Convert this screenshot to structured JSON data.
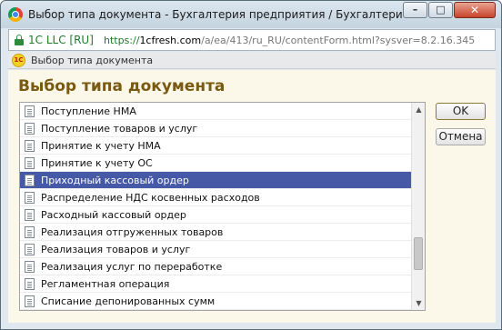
{
  "window": {
    "title": "Выбор типа документа - Бухгалтерия предприятия / Бухгалтерия предпр",
    "minimize_glyph": "–",
    "maximize_glyph": "□",
    "close_glyph": "✕"
  },
  "address_bar": {
    "cert_label": "1C LLC [RU]",
    "url_scheme": "https://",
    "url_host": "1cfresh.com",
    "url_path": "/a/ea/413/ru_RU/contentForm.html?sysver=8.2.16.345"
  },
  "page_strip": {
    "icon_text": "1С",
    "label": "Выбор типа документа"
  },
  "form": {
    "title": "Выбор типа документа",
    "items": [
      {
        "label": "Поступление НМА",
        "selected": false
      },
      {
        "label": "Поступление товаров и услуг",
        "selected": false
      },
      {
        "label": "Принятие к учету НМА",
        "selected": false
      },
      {
        "label": "Принятие к учету ОС",
        "selected": false
      },
      {
        "label": "Приходный кассовый ордер",
        "selected": true
      },
      {
        "label": "Распределение НДС косвенных расходов",
        "selected": false
      },
      {
        "label": "Расходный кассовый ордер",
        "selected": false
      },
      {
        "label": "Реализация отгруженных товаров",
        "selected": false
      },
      {
        "label": "Реализация товаров и услуг",
        "selected": false
      },
      {
        "label": "Реализация услуг по переработке",
        "selected": false
      },
      {
        "label": "Регламентная операция",
        "selected": false
      },
      {
        "label": "Списание депонированных сумм",
        "selected": false
      }
    ],
    "buttons": {
      "ok": "OK",
      "cancel": "Отмена"
    },
    "scroll_up_glyph": "▲",
    "scroll_down_glyph": "▼"
  },
  "colors": {
    "selection": "#4659a6",
    "title_text": "#7a5910",
    "form_background": "#fbf8e9"
  }
}
